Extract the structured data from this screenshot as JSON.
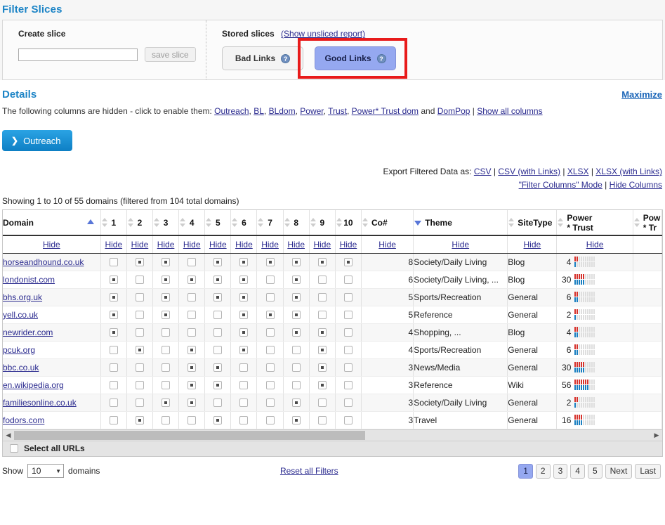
{
  "filter_slices": {
    "title": "Filter Slices",
    "create": {
      "label": "Create slice",
      "input_value": "",
      "input_placeholder": "",
      "save_label": "save slice"
    },
    "stored": {
      "label": "Stored slices",
      "unsliced_link": "(Show unsliced report)",
      "buttons": [
        {
          "label": "Bad Links",
          "help": "?",
          "active": false
        },
        {
          "label": "Good Links",
          "help": "?",
          "active": true
        }
      ]
    }
  },
  "details": {
    "title": "Details",
    "maximize": "Maximize",
    "hidden_prefix": "The following columns are hidden - click to enable them:",
    "hidden_columns": [
      "Outreach",
      "BL",
      "BLdom",
      "Power",
      "Trust",
      "Power* Trust dom",
      "DomPop"
    ],
    "hidden_and": "and",
    "show_all": "Show all columns",
    "outreach_button": "Outreach",
    "outreach_chevron": "chevron-right-icon"
  },
  "export": {
    "label": "Export Filtered Data as:",
    "links": [
      "CSV",
      "CSV (with Links)",
      "XLSX",
      "XLSX (with Links)"
    ],
    "mode_links": [
      "\"Filter Columns\" Mode",
      "Hide Columns"
    ]
  },
  "table": {
    "showing": "Showing 1 to 10 of 55 domains (filtered from 104 total domains)",
    "hide_label": "Hide",
    "columns": [
      {
        "key": "domain",
        "label": "Domain",
        "sort": "asc"
      },
      {
        "key": "c1",
        "label": "1",
        "sort": "both"
      },
      {
        "key": "c2",
        "label": "2",
        "sort": "both"
      },
      {
        "key": "c3",
        "label": "3",
        "sort": "both"
      },
      {
        "key": "c4",
        "label": "4",
        "sort": "both"
      },
      {
        "key": "c5",
        "label": "5",
        "sort": "both"
      },
      {
        "key": "c6",
        "label": "6",
        "sort": "both"
      },
      {
        "key": "c7",
        "label": "7",
        "sort": "both"
      },
      {
        "key": "c8",
        "label": "8",
        "sort": "both"
      },
      {
        "key": "c9",
        "label": "9",
        "sort": "both"
      },
      {
        "key": "c10",
        "label": "10",
        "sort": "both"
      },
      {
        "key": "co",
        "label": "Co#",
        "sort": "both"
      },
      {
        "key": "theme",
        "label": "Theme",
        "sort": "desc"
      },
      {
        "key": "sitetype",
        "label": "SiteType",
        "sort": "both"
      },
      {
        "key": "powertrust",
        "label": "Power\n* Trust",
        "sort": "both"
      },
      {
        "key": "powertrustdom",
        "label": "Pow\n* Tr",
        "sort": "both"
      }
    ],
    "rows": [
      {
        "domain": "horseandhound.co.uk",
        "checks": [
          0,
          1,
          1,
          0,
          1,
          1,
          1,
          1,
          1,
          1
        ],
        "co": "8",
        "theme": "Society/Daily Living",
        "sitetype": "Blog",
        "pt": "4",
        "red": 2,
        "blue": 1
      },
      {
        "domain": "londonist.com",
        "checks": [
          1,
          0,
          1,
          1,
          1,
          1,
          0,
          1,
          0,
          0
        ],
        "co": "6",
        "theme": "Society/Daily Living, ...",
        "sitetype": "Blog",
        "pt": "30",
        "red": 5,
        "blue": 5
      },
      {
        "domain": "bhs.org.uk",
        "checks": [
          1,
          0,
          1,
          0,
          1,
          1,
          0,
          1,
          0,
          0
        ],
        "co": "5",
        "theme": "Sports/Recreation",
        "sitetype": "General",
        "pt": "6",
        "red": 2,
        "blue": 2
      },
      {
        "domain": "yell.co.uk",
        "checks": [
          1,
          0,
          1,
          0,
          0,
          1,
          1,
          1,
          0,
          0
        ],
        "co": "5",
        "theme": "Reference",
        "sitetype": "General",
        "pt": "2",
        "red": 2,
        "blue": 1
      },
      {
        "domain": "newrider.com",
        "checks": [
          1,
          0,
          0,
          0,
          0,
          1,
          0,
          1,
          1,
          0
        ],
        "co": "4",
        "theme": "Shopping, ...",
        "sitetype": "Blog",
        "pt": "4",
        "red": 2,
        "blue": 2
      },
      {
        "domain": "pcuk.org",
        "checks": [
          0,
          1,
          0,
          1,
          0,
          1,
          0,
          0,
          1,
          0
        ],
        "co": "4",
        "theme": "Sports/Recreation",
        "sitetype": "General",
        "pt": "6",
        "red": 2,
        "blue": 2
      },
      {
        "domain": "bbc.co.uk",
        "checks": [
          0,
          0,
          0,
          1,
          1,
          0,
          0,
          0,
          1,
          0
        ],
        "co": "3",
        "theme": "News/Media",
        "sitetype": "General",
        "pt": "30",
        "red": 5,
        "blue": 5
      },
      {
        "domain": "en.wikipedia.org",
        "checks": [
          0,
          0,
          0,
          1,
          1,
          0,
          0,
          0,
          1,
          0
        ],
        "co": "3",
        "theme": "Reference",
        "sitetype": "Wiki",
        "pt": "56",
        "red": 7,
        "blue": 7
      },
      {
        "domain": "familiesonline.co.uk",
        "checks": [
          0,
          0,
          1,
          1,
          0,
          0,
          0,
          1,
          0,
          0
        ],
        "co": "3",
        "theme": "Society/Daily Living",
        "sitetype": "General",
        "pt": "2",
        "red": 2,
        "blue": 1
      },
      {
        "domain": "fodors.com",
        "checks": [
          0,
          1,
          0,
          0,
          1,
          0,
          0,
          1,
          0,
          0
        ],
        "co": "3",
        "theme": "Travel",
        "sitetype": "General",
        "pt": "16",
        "red": 4,
        "blue": 4
      }
    ],
    "select_all_label": "Select all URLs",
    "meter_segments": 10,
    "meter_red_color": "#d6322c",
    "meter_blue_color": "#1a7fc1"
  },
  "footer": {
    "show_label": "Show",
    "page_size": "10",
    "domains_label": "domains",
    "reset_label": "Reset all Filters",
    "pages": [
      "1",
      "2",
      "3",
      "4",
      "5"
    ],
    "active_page": "1",
    "next_label": "Next",
    "last_label": "Last"
  },
  "colors": {
    "accent_blue": "#1c84c6",
    "link": "#2b2b8f",
    "highlight_red": "#e81b1b",
    "active_button": "#95a8f0"
  }
}
